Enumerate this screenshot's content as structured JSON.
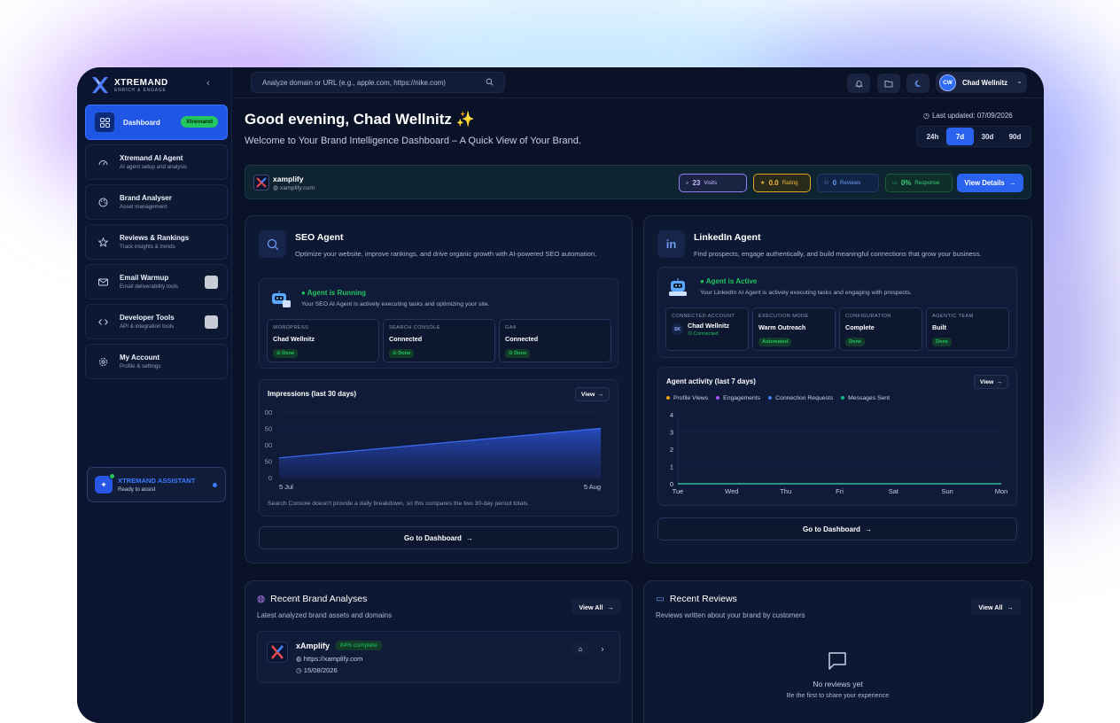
{
  "app": {
    "logo_name": "XTREMAND",
    "logo_tag": "ENRICH & ENGAGE"
  },
  "sidebar": {
    "items": [
      {
        "title": "Dashboard",
        "sub": "",
        "badge": "Xtremand",
        "icon": "grid-icon"
      },
      {
        "title": "Xtremand AI Agent",
        "sub": "AI agent setup and analysis",
        "icon": "gauge-icon"
      },
      {
        "title": "Brand Analyser",
        "sub": "Asset management",
        "icon": "palette-icon"
      },
      {
        "title": "Reviews & Rankings",
        "sub": "Track insights & trends",
        "icon": "star-icon"
      },
      {
        "title": "Email Warmup",
        "sub": "Email deliverability tools",
        "icon": "mail-icon"
      },
      {
        "title": "Developer Tools",
        "sub": "API & integration tools",
        "icon": "code-icon"
      },
      {
        "title": "My Account",
        "sub": "Profile & settings",
        "icon": "gear-icon"
      }
    ],
    "assistant": {
      "title": "XTREMAND ASSISTANT",
      "sub": "Ready to assist"
    }
  },
  "topbar": {
    "search_placeholder": "Analyze domain or URL (e.g., apple.com, https://nike.com)",
    "user_initials": "CW",
    "user_name": "Chad Wellnitz"
  },
  "header": {
    "greeting": "Good evening, Chad Wellnitz ✨",
    "welcome": "Welcome to Your Brand Intelligence Dashboard – A Quick View of Your Brand.",
    "last_updated": "Last updated: 07/09/2026",
    "ranges": [
      "24h",
      "7d",
      "30d",
      "90d"
    ],
    "active_range": "7d"
  },
  "brand": {
    "name": "xamplify",
    "url": "xamplify.com",
    "visits_value": "23",
    "visits_label": "Visits",
    "rating_value": "0.0",
    "rating_label": "Rating",
    "reviews_value": "0",
    "reviews_label": "Reviews",
    "response_value": "0%",
    "response_label": "Response",
    "view_details": "View Details"
  },
  "seo": {
    "title": "SEO Agent",
    "desc": "Optimize your website, improve rankings, and drive organic growth with AI-powered SEO automation.",
    "status_title": "Agent is Running",
    "status_sub": "Your SEO AI Agent is actively executing tasks and optimizing your site.",
    "tiles": [
      {
        "label": "WORDPRESS",
        "value": "Chad Wellnitz",
        "badge": "Done"
      },
      {
        "label": "SEARCH CONSOLE",
        "value": "Connected",
        "badge": "Done"
      },
      {
        "label": "GA4",
        "value": "Connected",
        "badge": "Done"
      }
    ],
    "chart_title": "Impressions (last 30 days)",
    "chart_view": "View",
    "chart_note": "Search Console doesn't provide a daily breakdown, so this compares the two 30-day period totals.",
    "go": "Go to Dashboard"
  },
  "linkedin": {
    "title": "LinkedIn Agent",
    "desc": "Find prospects, engage authentically, and build meaningful connections that grow your business.",
    "status_title": "Agent is Active",
    "status_sub": "Your LinkedIn AI Agent is actively executing tasks and engaging with prospects.",
    "tiles": [
      {
        "label": "CONNECTED ACCOUNT",
        "value": "Chad Wellnitz",
        "badge": "Connected",
        "initials": "SK"
      },
      {
        "label": "EXECUTION MODE",
        "value": "Warm Outreach",
        "badge": "Automated"
      },
      {
        "label": "CONFIGURATION",
        "value": "Complete",
        "badge": "Done"
      },
      {
        "label": "AGENTIC TEAM",
        "value": "Built",
        "badge": "Done"
      }
    ],
    "chart_title": "Agent activity (last 7 days)",
    "chart_view": "View",
    "go": "Go to Dashboard"
  },
  "colors": {
    "profile_views": "#f59e0b",
    "engagements": "#a855f7",
    "connection_requests": "#3b82f6",
    "messages_sent": "#10b981",
    "accent": "#2a63ef"
  },
  "chart_data": [
    {
      "type": "area",
      "title": "Impressions (last 30 days)",
      "x": [
        "5 Jul",
        "5 Aug"
      ],
      "values": [
        30,
        75
      ],
      "ytick_labels": [
        "00",
        "50",
        "00",
        "50",
        "0"
      ],
      "ylim": [
        0,
        100
      ]
    },
    {
      "type": "line",
      "title": "Agent activity (last 7 days)",
      "categories": [
        "Tue",
        "Wed",
        "Thu",
        "Fri",
        "Sat",
        "Sun",
        "Mon"
      ],
      "series": [
        {
          "name": "Profile Views",
          "values": [
            0,
            0,
            0,
            0,
            0,
            0,
            0
          ]
        },
        {
          "name": "Engagements",
          "values": [
            0,
            0,
            0,
            0,
            0,
            0,
            0
          ]
        },
        {
          "name": "Connection Requests",
          "values": [
            0,
            0,
            0,
            0,
            0,
            0,
            0
          ]
        },
        {
          "name": "Messages Sent",
          "values": [
            0,
            0,
            0,
            0,
            0,
            0,
            0
          ]
        }
      ],
      "yticks": [
        "0",
        "1",
        "2",
        "3",
        "4"
      ],
      "ylim": [
        0,
        4
      ]
    }
  ],
  "recent_analyses": {
    "title": "Recent Brand Analyses",
    "sub": "Latest analyzed brand assets and domains",
    "view_all": "View All",
    "item": {
      "name": "xAmplify",
      "progress": "84% complete",
      "url": "https://xamplify.com",
      "date": "15/08/2026"
    }
  },
  "recent_reviews": {
    "title": "Recent Reviews",
    "sub": "Reviews written about your brand by customers",
    "view_all": "View All",
    "empty_title": "No reviews yet",
    "empty_sub": "Be the first to share your experience"
  }
}
